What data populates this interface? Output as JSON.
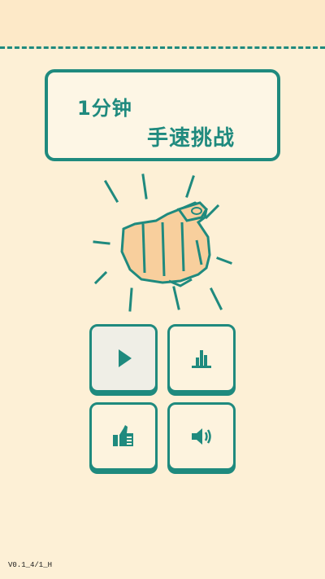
{
  "title": {
    "line1": "1分钟",
    "line2": "手速挑战"
  },
  "buttons": [
    {
      "name": "play-button",
      "icon": "play-icon"
    },
    {
      "name": "leaderboard-button",
      "icon": "bar-chart-icon"
    },
    {
      "name": "like-button",
      "icon": "thumbs-up-icon"
    },
    {
      "name": "sound-button",
      "icon": "speaker-icon"
    }
  ],
  "version": "V0.1_4/1_H",
  "colors": {
    "accent": "#1f8a7e",
    "background": "#fdf0d6",
    "skin": "#f8cf9d"
  }
}
